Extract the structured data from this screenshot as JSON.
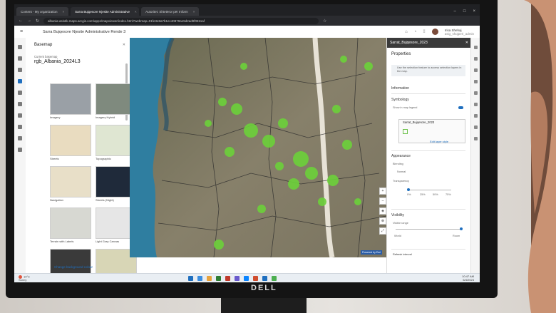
{
  "browser": {
    "tabs": [
      {
        "label": "Content - My organization",
        "active": false
      },
      {
        "label": "Sarra Bujqesore Njesite Administrative",
        "active": true
      },
      {
        "label": "Autoritet: Shtetëror për Inform",
        "active": false
      }
    ],
    "url": "albania-asistik.maps.arcgis.com/apps/mapviewer/index.html?webmap=01fe3e8a7b1ec40879a15d2ad9f0811af"
  },
  "app": {
    "title": "Sarra Bujqesore Njesite Administrative Rende 3",
    "user_name": "Irisa Shehaj",
    "user_sub": "asig_shqiperi_admin"
  },
  "basemap": {
    "title": "Basemap",
    "current_label": "Current basemap",
    "current_name": "rgb_Albania_2024L3",
    "items": [
      {
        "label": "Imagery",
        "color": "#9aa0a6"
      },
      {
        "label": "Imagery Hybrid",
        "color": "#7f8a7e"
      },
      {
        "label": "Streets",
        "color": "#e9dcc0"
      },
      {
        "label": "Topographic",
        "color": "#dfe6d2"
      },
      {
        "label": "Navigation",
        "color": "#e8dfc8"
      },
      {
        "label": "Streets (Night)",
        "color": "#1f2a3a"
      },
      {
        "label": "Terrain with Labels",
        "color": "#d7d8d2"
      },
      {
        "label": "Light Gray Canvas",
        "color": "#e6e6e6"
      },
      {
        "label": "",
        "color": "#3a3a3a"
      },
      {
        "label": "",
        "color": "#d8d6b6"
      }
    ],
    "change_link": "Change background colour"
  },
  "properties": {
    "header": "Sarrat_Bujqesore_2023",
    "title": "Properties",
    "note": "Use the selection feature to access selection layers in the map.",
    "information": "Information",
    "symbology": "Symbology",
    "show_in_legend": "Show in map legend",
    "layer_name": "Sarrat_Bujqesore_2023",
    "edit_style": "Edit layer style",
    "appearance": "Appearance",
    "blending": "Blending",
    "blending_value": "Normal",
    "transparency": "Transparency",
    "transparency_ticks": [
      "0%",
      "25%",
      "50%",
      "75%"
    ],
    "visibility": "Visibility",
    "visible_range": "Visible range",
    "range_left": "World",
    "range_right": "Room",
    "refresh": "Refresh interval"
  },
  "map": {
    "powered": "Powered by Esri"
  },
  "taskbar": {
    "temp": "19°C",
    "weather": "Sunny",
    "time": "10:47 AM",
    "date": "6/4/2024",
    "icon_colors": [
      "#1f6fbf",
      "#3d8fe0",
      "#e8a33d",
      "#2f7d32",
      "#c0392b",
      "#6a5acd",
      "#0a84ff",
      "#d04e2f",
      "#1f6fbf",
      "#4caf50"
    ]
  },
  "monitor": {
    "brand": "DELL"
  }
}
